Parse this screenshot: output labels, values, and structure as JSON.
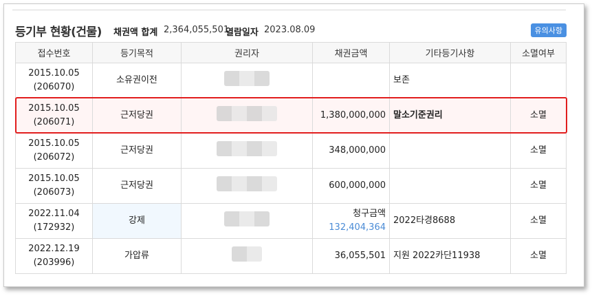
{
  "header": {
    "title": "등기부 현황(건물)",
    "sum_label": "채권액 합계",
    "sum_value": "2,364,055,501",
    "date_label": "열람일자",
    "date_value": "2023.08.09",
    "notice_button": "유의사항"
  },
  "table": {
    "columns": [
      "접수번호",
      "등기목적",
      "권리자",
      "채권금액",
      "기타등기사항",
      "소멸여부"
    ],
    "rows": [
      {
        "date": "2015.10.05",
        "no": "(206070)",
        "purpose": "소유권이전",
        "amount": "",
        "amount_sub": "",
        "etc": "보존",
        "status": ""
      },
      {
        "date": "2015.10.05",
        "no": "(206071)",
        "purpose": "근저당권",
        "amount": "1,380,000,000",
        "amount_sub": "",
        "etc": "말소기준권리",
        "status": "소멸"
      },
      {
        "date": "2015.10.05",
        "no": "(206072)",
        "purpose": "근저당권",
        "amount": "348,000,000",
        "amount_sub": "",
        "etc": "",
        "status": "소멸"
      },
      {
        "date": "2015.10.05",
        "no": "(206073)",
        "purpose": "근저당권",
        "amount": "600,000,000",
        "amount_sub": "",
        "etc": "",
        "status": "소멸"
      },
      {
        "date": "2022.11.04",
        "no": "(172932)",
        "purpose": "강제",
        "amount": "청구금액",
        "amount_sub": "132,404,364",
        "etc": "2022타경8688",
        "status": "소멸"
      },
      {
        "date": "2022.12.19",
        "no": "(203996)",
        "purpose": "가압류",
        "amount": "36,055,501",
        "amount_sub": "",
        "etc": "지원 2022카단11938",
        "status": "소멸"
      }
    ]
  },
  "colors": {
    "highlight_border": "#e11d1d",
    "highlight_bg": "#fff5f5",
    "accent": "#4a90e2"
  }
}
